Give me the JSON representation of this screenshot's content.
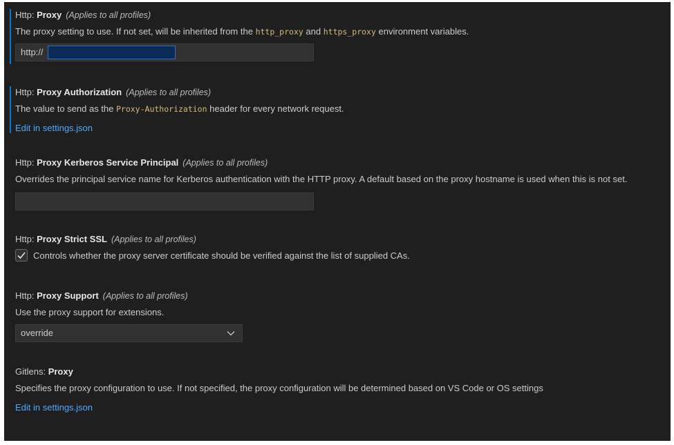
{
  "settings": {
    "proxy": {
      "category": "Http: ",
      "key": "Proxy",
      "scope": "(Applies to all profiles)",
      "desc_before": "The proxy setting to use. If not set, will be inherited from the ",
      "code1": "http_proxy",
      "desc_mid": " and ",
      "code2": "https_proxy",
      "desc_after": " environment variables.",
      "value": "http://"
    },
    "proxy_authorization": {
      "category": "Http: ",
      "key": "Proxy Authorization",
      "scope": "(Applies to all profiles)",
      "desc_before": "The value to send as the ",
      "code": "Proxy-Authorization",
      "desc_after": " header for every network request.",
      "link": "Edit in settings.json"
    },
    "proxy_kerberos": {
      "category": "Http: ",
      "key": "Proxy Kerberos Service Principal",
      "scope": "(Applies to all profiles)",
      "desc": "Overrides the principal service name for Kerberos authentication with the HTTP proxy. A default based on the proxy hostname is used when this is not set.",
      "value": ""
    },
    "proxy_strict_ssl": {
      "category": "Http: ",
      "key": "Proxy Strict SSL",
      "scope": "(Applies to all profiles)",
      "checkbox_label": "Controls whether the proxy server certificate should be verified against the list of supplied CAs.",
      "checked": true
    },
    "proxy_support": {
      "category": "Http: ",
      "key": "Proxy Support",
      "scope": "(Applies to all profiles)",
      "desc": "Use the proxy support for extensions.",
      "selected": "override"
    },
    "gitlens_proxy": {
      "category": "Gitlens: ",
      "key": "Proxy",
      "desc": "Specifies the proxy configuration to use. If not specified, the proxy configuration will be determined based on VS Code or OS settings",
      "link": "Edit in settings.json"
    }
  },
  "colors": {
    "background": "#1f1f1f",
    "modified_indicator": "#0078d4",
    "link": "#4daafc",
    "code": "#d7ba7d"
  }
}
